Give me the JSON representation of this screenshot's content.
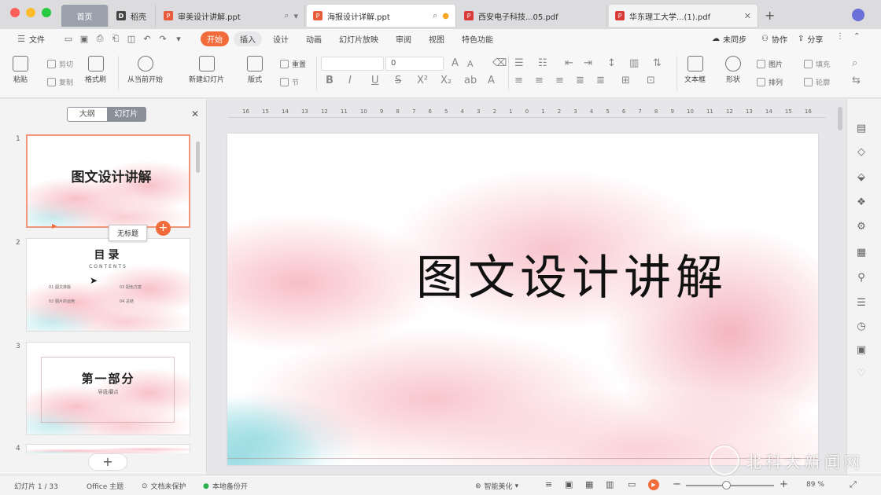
{
  "tabs": {
    "home": "首页",
    "items": [
      {
        "label": "稻壳",
        "icon": "docer-icon"
      },
      {
        "label": "审美设计讲解.ppt",
        "icon": "ppt-file-icon"
      },
      {
        "label": "海报设计详解.ppt",
        "icon": "ppt-file-icon"
      },
      {
        "label": "西安电子科技...05.pdf",
        "icon": "pdf-file-icon"
      },
      {
        "label": "华东理工大学...(1).pdf",
        "icon": "pdf-file-icon"
      }
    ]
  },
  "menu": {
    "file": "文件",
    "items": [
      "开始",
      "插入",
      "设计",
      "动画",
      "幻灯片放映",
      "审阅",
      "视图",
      "特色功能"
    ],
    "active": "开始",
    "sync": "未同步",
    "collab": "协作",
    "share": "分享"
  },
  "ribbon": {
    "paste": "粘贴",
    "cut": "剪切",
    "copy": "复制",
    "format_painter": "格式刷",
    "from_current": "从当前开始",
    "new_slide": "新建幻灯片",
    "layout": "版式",
    "reset": "重置",
    "section": "节",
    "font_size": "0",
    "textbox": "文本框",
    "shape": "形状",
    "picture": "图片",
    "fill": "填充",
    "arrange": "排列",
    "outline": "轮廓"
  },
  "panel": {
    "seg_outline": "大纲",
    "seg_slides": "幻灯片",
    "tooltip": "无标题",
    "add": "+",
    "slides": [
      {
        "num": "1",
        "title": "图文设计讲解"
      },
      {
        "num": "2",
        "title": "目录",
        "subtitle": "CONTENTS",
        "toc": [
          "01 图文排版",
          "02 图片的运用",
          "03 配色方案",
          "04 总结"
        ]
      },
      {
        "num": "3",
        "title": "第一部分",
        "subtitle": "导语/要点"
      },
      {
        "num": "4",
        "title": ""
      }
    ]
  },
  "ruler": [
    "16",
    "15",
    "14",
    "13",
    "12",
    "11",
    "10",
    "9",
    "8",
    "7",
    "6",
    "5",
    "4",
    "3",
    "2",
    "1",
    "0",
    "1",
    "2",
    "3",
    "4",
    "5",
    "6",
    "7",
    "8",
    "9",
    "10",
    "11",
    "12",
    "13",
    "14",
    "15",
    "16"
  ],
  "slide": {
    "title": "图文设计讲解"
  },
  "status": {
    "slide_count": "幻灯片 1 / 33",
    "theme": "Office 主题",
    "protect": "文档未保护",
    "backup": "本地备份开",
    "beautify": "智能美化",
    "zoom": "89 %"
  },
  "watermark": {
    "text": "北科大新闻网"
  },
  "colors": {
    "accent": "#f26b3a",
    "home_tab": "#9aa1ad",
    "ppt_icon": "#e85b3d",
    "pdf_icon": "#d93a3a",
    "selection": "#f29579"
  }
}
